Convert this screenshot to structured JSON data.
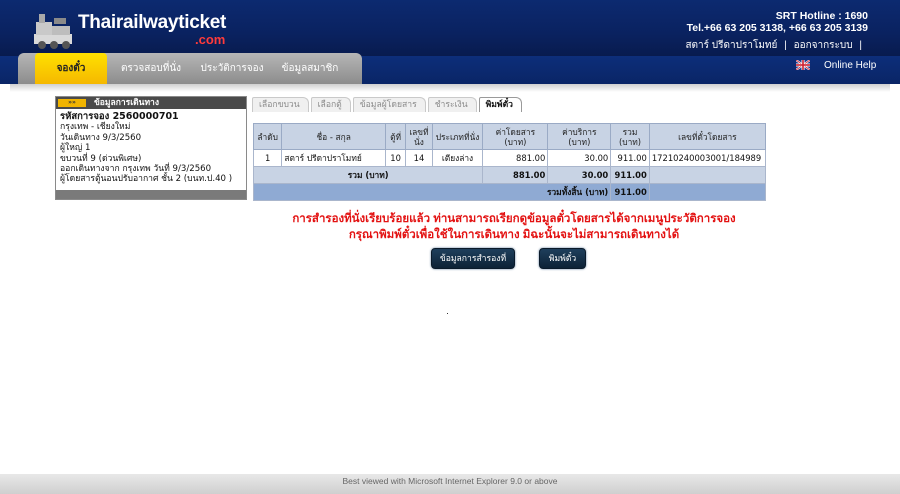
{
  "brand": {
    "name": "Thairailwayticket",
    "suffix": ".com",
    "accent_color": "#ff3b3b",
    "header_color": "#0c2a70"
  },
  "header": {
    "hotline": "SRT Hotline : 1690",
    "tel": "Tel.+66 63 205 3138, +66 63 205 3139",
    "user_name": "สตาร์ ปรีดาปราโมทย์",
    "separator": "|",
    "logout": "ออกจากระบบ",
    "trailing_sep": "|"
  },
  "nav": {
    "tabs": [
      {
        "label": "จองตั๋ว",
        "active": true
      },
      {
        "label": "ตรวจสอบที่นั่ง",
        "active": false
      },
      {
        "label": "ประวัติการจอง",
        "active": false
      },
      {
        "label": "ข้อมูลสมาชิก",
        "active": false
      }
    ],
    "online_help": "Online Help",
    "flag_icon": "uk-flag-icon"
  },
  "trip_info": {
    "title": "ข้อมูลการเดินทาง",
    "lines": [
      "รหัสการจอง 2560000701",
      "กรุงเทพ - เชียงใหม่",
      "วันเดินทาง 9/3/2560",
      "ผู้ใหญ่ 1",
      "ขบวนที่ 9 (ด่วนพิเศษ)",
      "ออกเดินทางจาก กรุงเทพ  วันที่ 9/3/2560",
      "ผู้โดยสารตู้นอนปรับอากาศ ชั้น 2 (บนท.ป.40 )"
    ]
  },
  "steps": [
    "เลือกขบวน",
    "เลือกตู้",
    "ข้อมูลผู้โดยสาร",
    "ชำระเงิน",
    "พิมพ์ตั๋ว"
  ],
  "table": {
    "headers": [
      "ลำดับ",
      "ชื่อ - สกุล",
      "ตู้ที่",
      "เลขที่นั่ง",
      "ประเภทที่นั่ง",
      "ค่าโดยสาร (บาท)",
      "ค่าบริการ (บาท)",
      "รวม (บาท)",
      "เลขที่ตั๋วโดยสาร"
    ],
    "rows": [
      [
        "1",
        "สตาร์ ปรีดาปราโมทย์",
        "10",
        "14",
        "เตียงล่าง",
        "881.00",
        "30.00",
        "911.00",
        "17210240003001/184989"
      ]
    ],
    "total_label": "รวม (บาท)",
    "total_fare": "881.00",
    "total_service": "30.00",
    "total_sum": "911.00",
    "grand_label": "รวมทั้งสิ้น (บาท)",
    "grand_total": "911.00"
  },
  "message": {
    "line1": "การสำรองที่นั่งเรียบร้อยแล้ว ท่านสามารถเรียกดูข้อมูลตั๋วโดยสารได้จากเมนูประวัติการจอง",
    "line2": "กรุณาพิมพ์ตั๋วเพื่อใช้ในการเดินทาง มิฉะนั้นจะไม่สามารถเดินทางได้",
    "color": "#e31212"
  },
  "buttons": {
    "booking_info": "ข้อมูลการสำรองที่",
    "print_ticket": "พิมพ์ตั๋ว"
  },
  "footer": {
    "text": "Best viewed with Microsoft Internet Explorer 9.0 or above"
  }
}
